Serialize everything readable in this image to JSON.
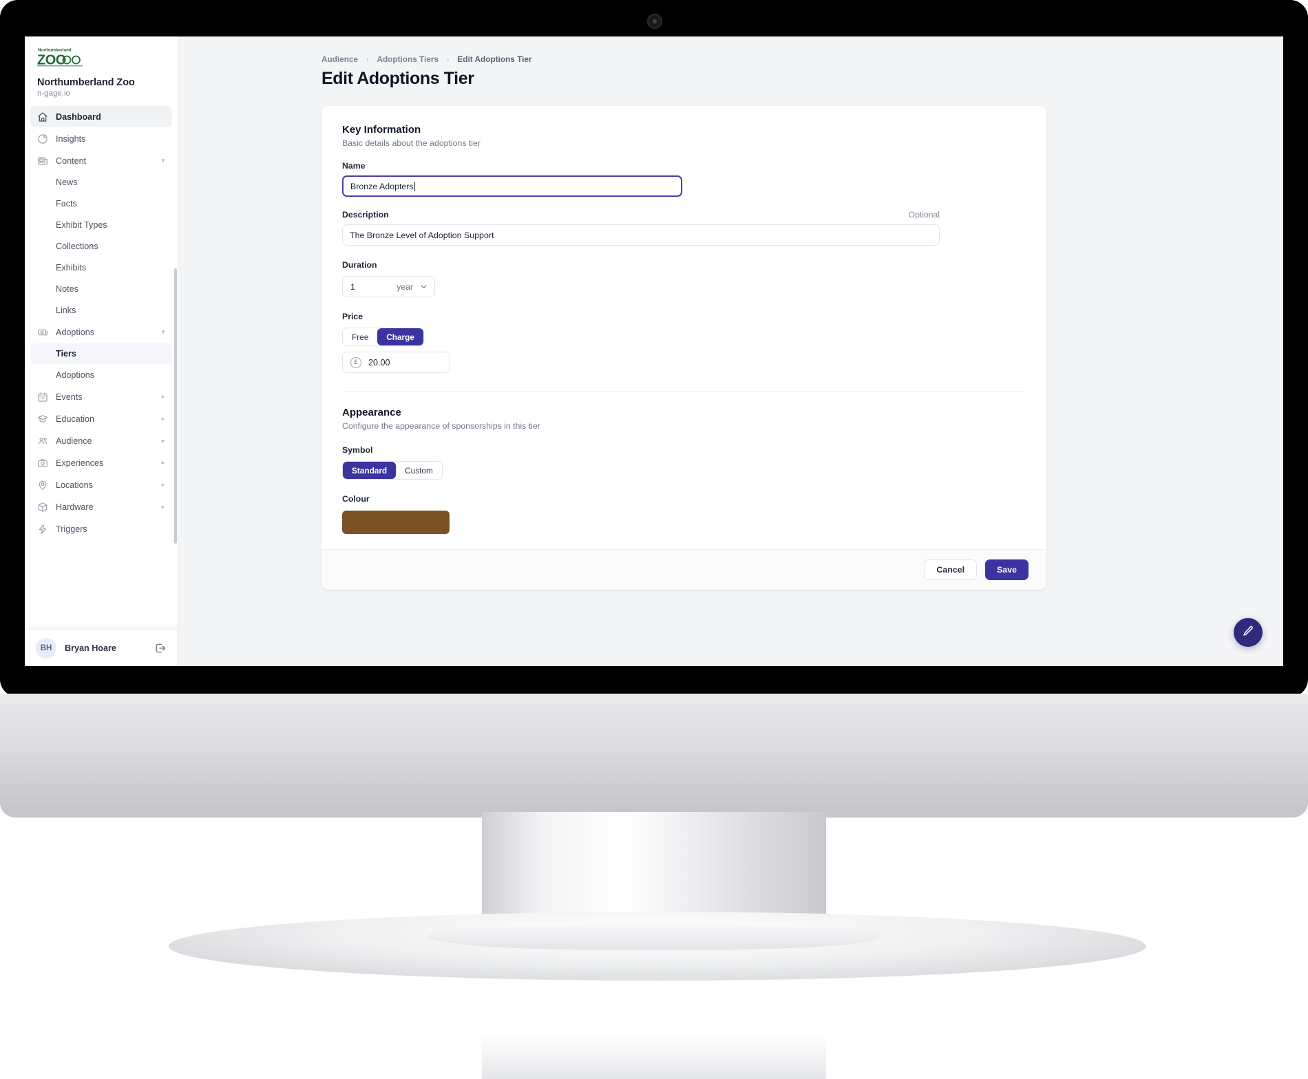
{
  "brand": {
    "logo_line1": "Northumberland",
    "logo_line2": "ZOO",
    "name": "Northumberland Zoo",
    "domain": "n-gage.io"
  },
  "sidebar": {
    "items": [
      {
        "label": "Dashboard",
        "icon": "home-icon",
        "state": "active",
        "level": "top"
      },
      {
        "label": "Insights",
        "icon": "pie-chart-icon",
        "level": "top"
      },
      {
        "label": "Content",
        "icon": "content-icon",
        "level": "top",
        "caret": "down"
      },
      {
        "label": "News",
        "level": "sub"
      },
      {
        "label": "Facts",
        "level": "sub"
      },
      {
        "label": "Exhibit Types",
        "level": "sub"
      },
      {
        "label": "Collections",
        "level": "sub"
      },
      {
        "label": "Exhibits",
        "level": "sub"
      },
      {
        "label": "Notes",
        "level": "sub"
      },
      {
        "label": "Links",
        "level": "sub"
      },
      {
        "label": "Adoptions",
        "icon": "adoptions-icon",
        "level": "top",
        "caret": "down"
      },
      {
        "label": "Tiers",
        "level": "sub",
        "state": "selected"
      },
      {
        "label": "Adoptions",
        "level": "sub"
      },
      {
        "label": "Events",
        "icon": "calendar-icon",
        "level": "top",
        "caret": "right"
      },
      {
        "label": "Education",
        "icon": "graduation-cap-icon",
        "level": "top",
        "caret": "right"
      },
      {
        "label": "Audience",
        "icon": "people-icon",
        "level": "top",
        "caret": "right"
      },
      {
        "label": "Experiences",
        "icon": "camera-icon",
        "level": "top",
        "caret": "right"
      },
      {
        "label": "Locations",
        "icon": "map-pin-icon",
        "level": "top",
        "caret": "right"
      },
      {
        "label": "Hardware",
        "icon": "cube-icon",
        "level": "top",
        "caret": "right"
      },
      {
        "label": "Triggers",
        "icon": "lightning-icon",
        "level": "top"
      }
    ],
    "user": {
      "initials": "BH",
      "name": "Bryan Hoare",
      "logout_icon": "logout-icon"
    }
  },
  "header": {
    "breadcrumbs": [
      "Audience",
      "Adoptions Tiers",
      "Edit Adoptions Tier"
    ],
    "separator": "›",
    "title": "Edit Adoptions Tier"
  },
  "key_information": {
    "title": "Key Information",
    "subtitle": "Basic details about the adoptions tier",
    "name": {
      "label": "Name",
      "value": "Bronze Adopters",
      "focused": true
    },
    "description": {
      "label": "Description",
      "optional_label": "Optional",
      "value": "The Bronze Level of Adoption Support"
    },
    "duration": {
      "label": "Duration",
      "value": "1",
      "unit": "year",
      "chevron_icon": "chevron-down-icon"
    },
    "price": {
      "label": "Price",
      "options": [
        "Free",
        "Charge"
      ],
      "selected": "Charge",
      "currency_symbol": "£",
      "amount": "20.00"
    }
  },
  "appearance": {
    "title": "Appearance",
    "subtitle": "Configure the appearance of sponsorships in this tier",
    "symbol": {
      "label": "Symbol",
      "options": [
        "Standard",
        "Custom"
      ],
      "selected": "Standard"
    },
    "colour": {
      "label": "Colour",
      "value": "#7A5226"
    }
  },
  "footer": {
    "cancel_label": "Cancel",
    "save_label": "Save"
  },
  "fab": {
    "icon": "pencil-icon"
  },
  "colors": {
    "accent": "#3b34a0",
    "focus_ring": "#4a42a8",
    "brand_green": "#1f6b37",
    "swatch": "#7A5226"
  }
}
